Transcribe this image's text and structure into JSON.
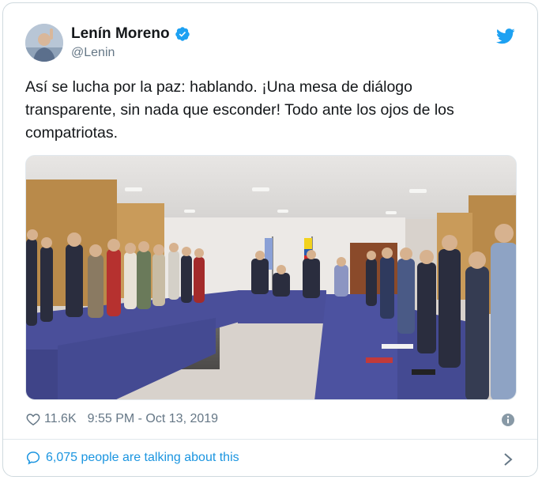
{
  "author": {
    "name": "Lenín Moreno",
    "handle": "@Lenin",
    "verified": true
  },
  "icons": {
    "brand": "twitter-bird-icon",
    "verified": "verified-badge-icon",
    "like": "heart-icon",
    "info": "info-icon",
    "conversation": "speech-bubble-icon",
    "chevron": "chevron-right-icon"
  },
  "tweet": {
    "text": "Así se lucha por la paz: hablando. ¡Una mesa de diálogo\ntransparente, sin nada que esconder! Todo ante los ojos de los\ncompatriotas."
  },
  "stats": {
    "likes": "11.6K",
    "timestamp": "9:55 PM - Oct 13, 2019"
  },
  "footer": {
    "conversation": "6,075 people are talking about this"
  },
  "colors": {
    "brand_blue": "#1da1f2",
    "link_blue": "#1b95e0",
    "muted": "#657786",
    "table_cloth": "#4a4f9a"
  }
}
